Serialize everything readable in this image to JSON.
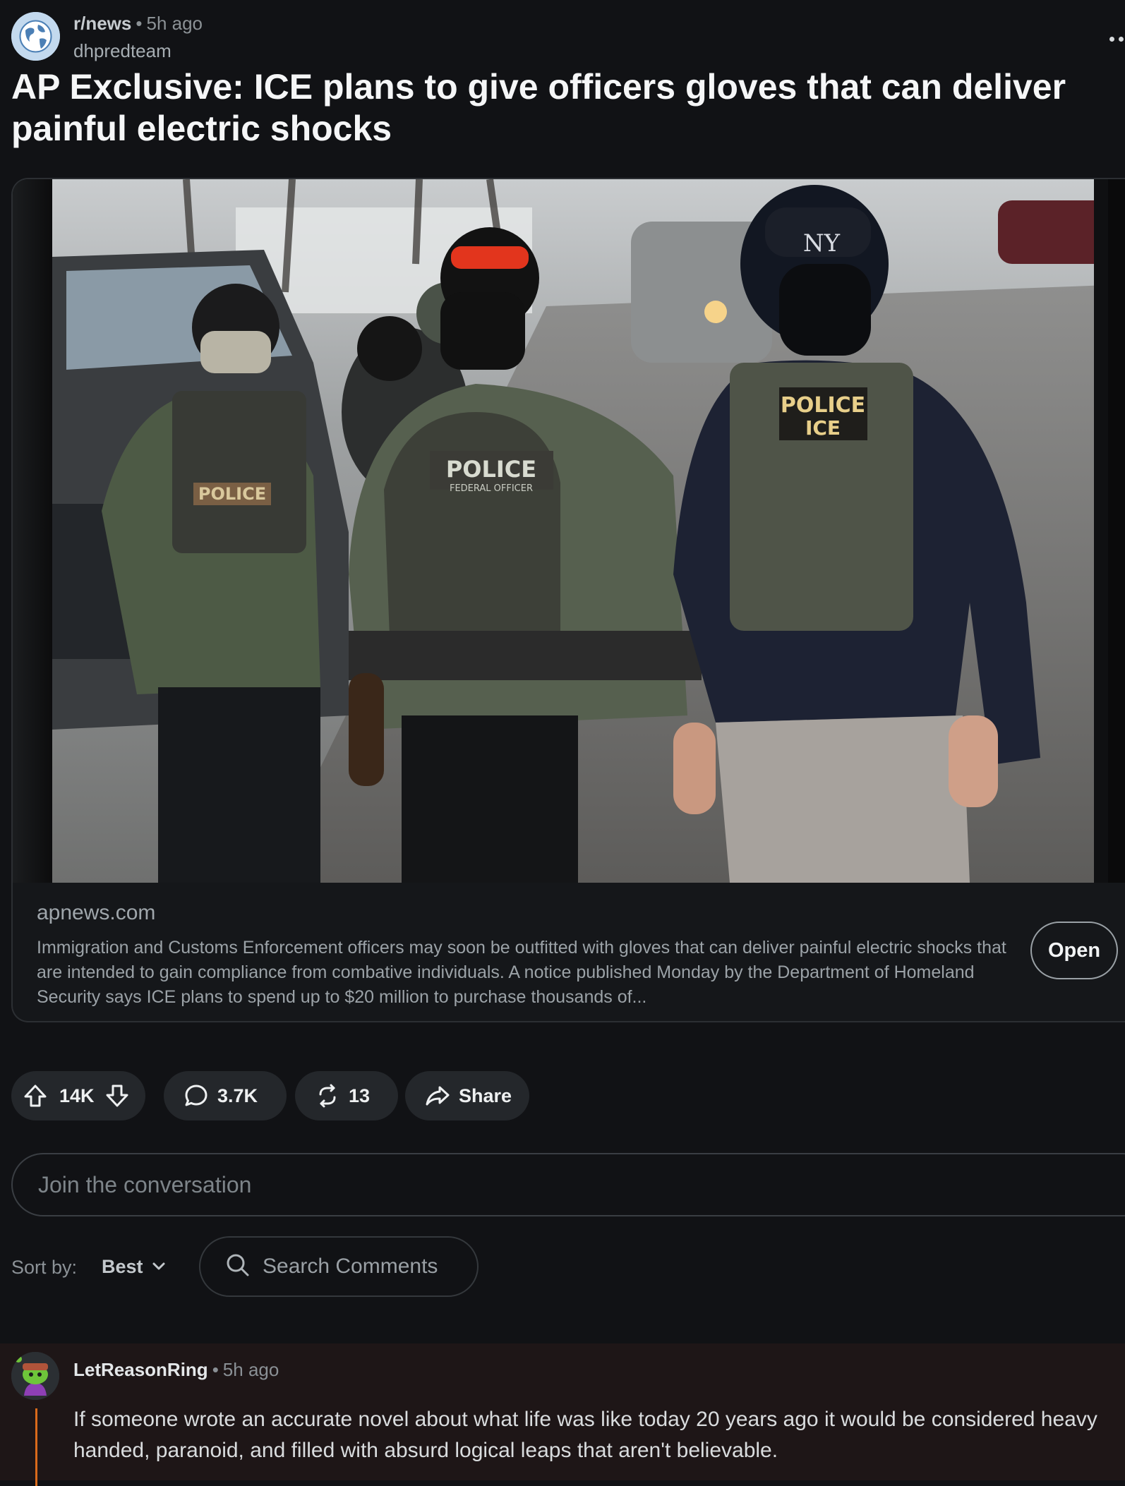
{
  "post": {
    "subreddit": "r/news",
    "separator": "•",
    "time_ago": "5h ago",
    "author": "dhpredteam",
    "more_icon": "overflow-dots-icon",
    "title": "AP Exclusive: ICE plans to give officers gloves that can deliver painful electric shocks"
  },
  "link_card": {
    "image_icon": "news-photo-thumbnail",
    "domain": "apnews.com",
    "description": "Immigration and Customs Enforcement officers may soon be outfitted with gloves that can deliver painful electric shocks that are intended to gain compliance from combative individuals. A notice published Monday by the Department of Homeland Security says ICE plans to spend up to $20 million to purchase thousands of...",
    "open_label": "Open",
    "photo_patch_texts": [
      "POLICE",
      "POLICE",
      "FEDERAL OFFICER",
      "POLICE",
      "ICE",
      "NY"
    ]
  },
  "actions": {
    "upvotes": "14K",
    "comments": "3.7K",
    "awards": "13",
    "share_label": "Share"
  },
  "comment_box": {
    "placeholder": "Join the conversation"
  },
  "sort": {
    "label": "Sort by:",
    "value": "Best",
    "search_placeholder": "Search Comments"
  },
  "comments": [
    {
      "author": "LetReasonRing",
      "separator": "•",
      "time_ago": "5h ago",
      "body": "If someone wrote an accurate novel about what life was like today 20 years ago it would be considered heavy handed, paranoid, and filled with absurd logical leaps that aren't believable."
    }
  ],
  "colors": {
    "background": "#111215",
    "pill": "#24272b",
    "thread_line": "#d96a1b",
    "comment_highlight": "#1e1617"
  }
}
